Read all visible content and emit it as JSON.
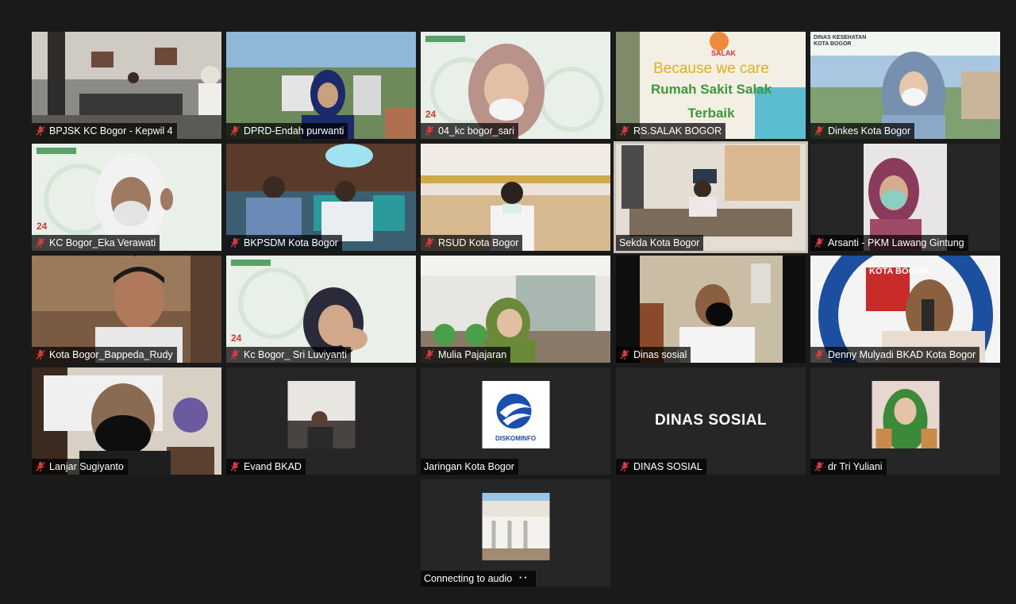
{
  "colors": {
    "background": "#1a1a1a",
    "tile": "#262626",
    "active_speaker": "#e6e84a",
    "muted_icon": "#e0393e"
  },
  "participants": [
    {
      "name": "BPJSK KC Bogor - Kepwil 4",
      "muted": true
    },
    {
      "name": "DPRD-Endah purwanti",
      "muted": true
    },
    {
      "name": "04_kc bogor_sari",
      "muted": true
    },
    {
      "name": "RS.SALAK BOGOR",
      "muted": true
    },
    {
      "name": "Dinkes Kota Bogor",
      "muted": true
    },
    {
      "name": "KC Bogor_Eka Verawati",
      "muted": true
    },
    {
      "name": "BKPSDM Kota Bogor",
      "muted": true
    },
    {
      "name": "RSUD Kota Bogor",
      "muted": true
    },
    {
      "name": "Sekda Kota Bogor",
      "muted": false,
      "active": true
    },
    {
      "name": "Arsanti - PKM Lawang Gintung",
      "muted": true
    },
    {
      "name": "Kota Bogor_Bappeda_Rudy",
      "muted": true
    },
    {
      "name": "Kc Bogor_ Sri Luviyanti",
      "muted": true
    },
    {
      "name": "Mulia Pajajaran",
      "muted": true
    },
    {
      "name": "Dinas sosial",
      "muted": true
    },
    {
      "name": "Denny Mulyadi BKAD Kota Bogor",
      "muted": true
    },
    {
      "name": "Lanjar Sugiyanto",
      "muted": true
    },
    {
      "name": "Evand BKAD",
      "muted": true
    },
    {
      "name": "Jaringan Kota Bogor",
      "muted": false
    },
    {
      "name": "DINAS SOSIAL",
      "muted": true
    },
    {
      "name": "dr Tri Yuliani",
      "muted": true
    },
    {
      "name": "Connecting to audio",
      "muted": false
    }
  ],
  "overlays": {
    "salak_banner_line1": "Because we care",
    "salak_banner_line2": "Rumah Sakit Salak",
    "salak_banner_line3": "Terbaik",
    "salak_logo": "SALAK",
    "diskominfo_logo": "DISKOMINFO",
    "dinas_sosial_text": "DINAS SOSIAL",
    "dinkes_header": "DINAS KESEHATAN KOTA BOGOR",
    "bkad_seal": "KOTA BOGOR",
    "connecting_dots": "⠐⠂"
  }
}
